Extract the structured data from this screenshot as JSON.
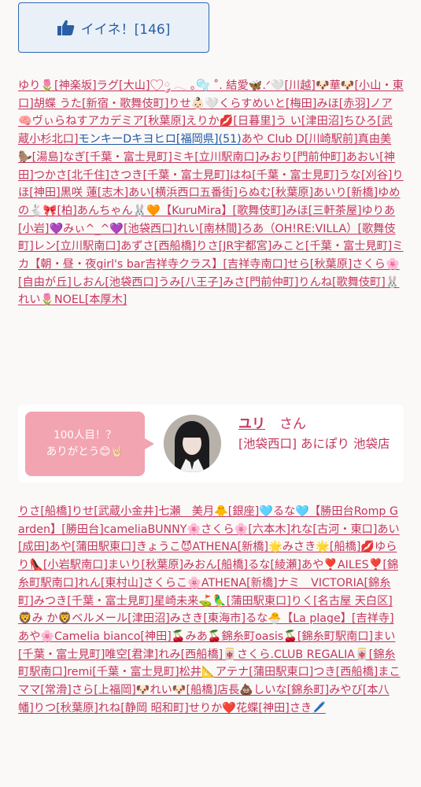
{
  "like_button": {
    "label": "イイネ！[146]",
    "icon": "thumbs-up-icon",
    "color": "#2a5fa3"
  },
  "names_block_1": "ゆり🌷[神楽坂]ラグ[大山]🤍︎︎༘ 𓂃 ｡🫧 ˚. 結愛🦋.ᐟ🤍[川越]🐶華🐶[小山・東口]胡蝶 うた[新宿・歌舞伎町]りせ👶🏻🤍くらすめいと[梅田]みほ[赤羽]ノア🧠ヴぃらねすアカデミア[秋葉原]えりか💋[日暮里]う い[津田沼]ちひろ[武蔵小杉北口]モンキーDキヨヒロ[福岡県](51)あや Club D[川崎駅前]真由美🦫[湯島]なぎ[千葉・富士見町]ミキ[立川駅南口]みおり[門前仲町]あおい[神田]つかさ[北千住]さつき[千葉・富士見町]はね[千葉・富士見町]うな[刈谷]りほ[神田]黒咲 蓮[志木]あい[横浜西口五番街]らぬむ[秋葉原]あいり[新橋]ゆめの🐇🎀[柏]あんちゃん🐰🧡【KuruMira】[歌舞伎町]みほ[三軒茶屋]ゆりあ[小岩]💜みぃ^_^💜[池袋西口]れい[南林間]ろあ（OH!RE:VILLA）[歌舞伎町]レン[立川駅南口]あずさ[西船橋]りさ[JR宇都宮]みこと[千葉・富士見町]ミカ【朝・昼・夜girl's bar吉祥寺クラス】[吉祥寺南口]せら[秋葉原]さくら🌸[自由が丘]しおん[池袋西口]うみ[八王子]みさ[門前仲町]りんね[歌舞伎町]🐰れい🌷NOEL[本厚木]",
  "names_block_1_highlight": "モンキーDキヨヒロ[福岡県](51)",
  "cast_card": {
    "bubble_line1": "100人目！？",
    "bubble_line2": "ありがとう😊🤘🏻",
    "name": "ユリ",
    "honorific": "さん",
    "shop": "[池袋西口] あにぽり 池袋店",
    "bubble_color": "#f2a4b1"
  },
  "names_block_2": "りさ[船橋]りせ[武蔵小金井]七瀬　美月🐥[銀座]🩵るな🩵【勝田台Romp Garden】[勝田台]cameliaBUNNY🌸さくら🌸[六本木]れな[古河・東口]あい[成田]あや[蒲田駅東口]きょうこ😈ATHENA[新橋]🌟みさき🌟[船橋]💋ゆらり👠[小岩駅南口]まいり[秋葉原]みおん[船橋]るな[綾瀬]あや❣️AILES❣️[錦糸町駅南口]れん[東村山]さくらこ🌸ATHENA[新橋]ナミ　VICTORIA[錦糸町]みつき[千葉・富士見町]星崎未来⛳️🦜[蒲田駅東口]りく[名古屋 天白区]🦁み か🦁ベルメール[津田沼]みさき[東海市]るな🐣【La plage】[吉祥寺]あや🌸Camelia bianco[神田]🍒みあ🍒錦糸町oasis🍒[錦糸町駅南口]まい[千葉・富士見町]唯空[君津]れみ[西船橋]🀄さくら.CLUB REGALIA🀄[錦糸町駅南口]remi[千葉・富士見町]松井📐アテナ[蒲田駅東口]つき[西船橋]まこママ[常滑]さら[上福岡]🐶れい🐶[船橋]店長💩しいな[錦糸町]みやび[本八幡]りつ[秋葉原]れね[静岡 昭和町]せりか❤️花蝶[神田]さき🖊️",
  "colors": {
    "background": "#fbf8f8",
    "link_pink": "#c4365d",
    "link_blue": "#1f5aa6",
    "like_border": "#2f69b0"
  }
}
